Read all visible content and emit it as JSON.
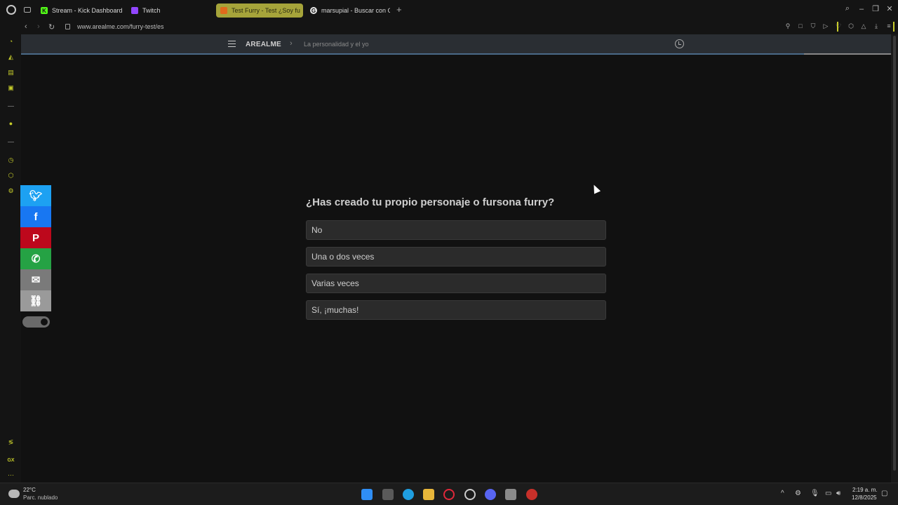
{
  "tabs": [
    {
      "label": "Stream - Kick Dashboard",
      "favicon": "K"
    },
    {
      "label": "Twitch",
      "favicon": ""
    },
    {
      "label": "Test Furry - Test ¿Soy fu",
      "favicon": ""
    },
    {
      "label": "marsupial - Buscar con G",
      "favicon": "G"
    }
  ],
  "address": {
    "url": "www.arealme.com/furry-test/es"
  },
  "site_header": {
    "brand": "AREALME",
    "separator": "›",
    "breadcrumb": "La personalidad y el yo"
  },
  "quiz": {
    "question": "¿Has creado tu propio personaje o fursona furry?",
    "options": [
      "No",
      "Una o dos veces",
      "Varias veces",
      "Sí, ¡muchas!"
    ]
  },
  "taskbar": {
    "temperature": "22°C",
    "condition": "Parc. nublado",
    "time": "2:19 a. m.",
    "date": "12/8/2025"
  },
  "colors": {
    "accent": "#c8cc2b",
    "active_tab": "#a6a43a",
    "twitter": "#1da1f2",
    "facebook": "#1877f2",
    "pinterest": "#bd081c",
    "whatsapp": "#25a244"
  }
}
